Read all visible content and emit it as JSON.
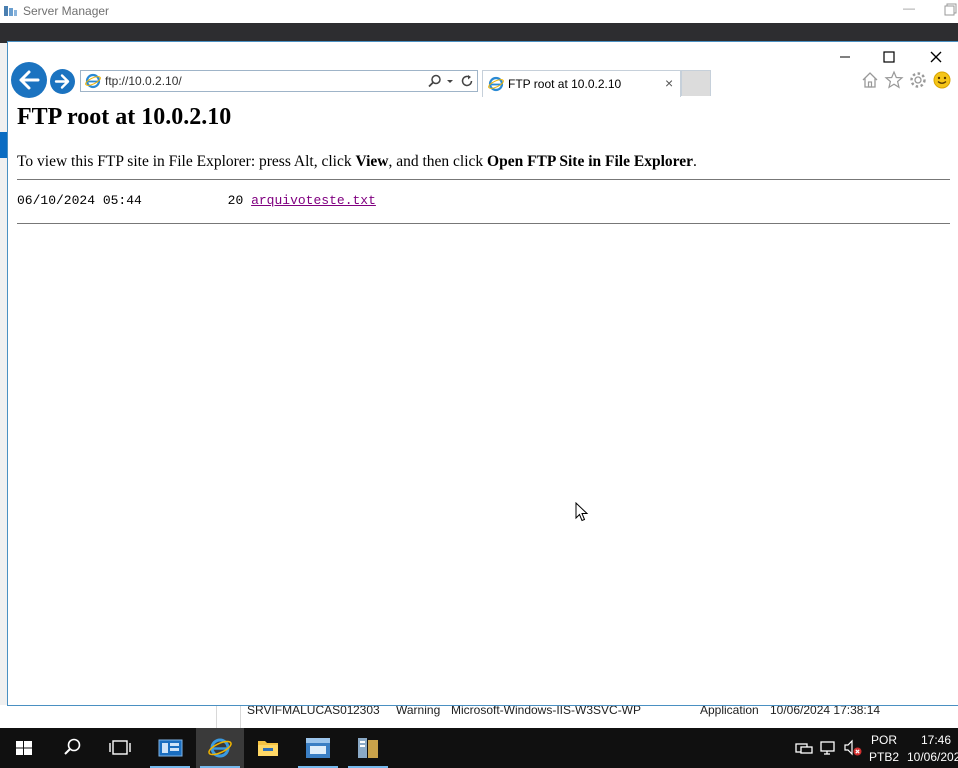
{
  "server_manager": {
    "title": "Server Manager",
    "event_row": {
      "server": "SRVIFMALUCAS01",
      "id": "2303",
      "severity": "Warning",
      "source": "Microsoft-Windows-IIS-W3SVC-WP",
      "log": "Application",
      "datetime": "10/06/2024 17:38:14"
    }
  },
  "browser": {
    "address": "ftp://10.0.2.10/",
    "tab_title": "FTP root at 10.0.2.10",
    "icons": {
      "back": "back-arrow-icon",
      "forward": "forward-arrow-icon",
      "home": "home-icon",
      "favorites": "star-icon",
      "tools": "gear-icon",
      "feedback": "smiley-icon"
    }
  },
  "page": {
    "heading": "FTP root at 10.0.2.10",
    "instr_pre": "To view this FTP site in File Explorer: press Alt, click ",
    "instr_view": "View",
    "instr_mid": ", and then click ",
    "instr_open": "Open FTP Site in File Explorer",
    "instr_end": ".",
    "files": [
      {
        "date": "06/10/2024 05:44",
        "size": "20",
        "name": "arquivoteste.txt"
      }
    ]
  },
  "taskbar": {
    "items": [
      "start-icon",
      "search-icon",
      "task-view-icon",
      "server-manager-icon",
      "internet-explorer-icon",
      "file-explorer-icon",
      "server-tools-icon",
      "event-viewer-icon"
    ],
    "tray": {
      "lang_top": "POR",
      "lang_bottom": "PTB2",
      "time": "17:46",
      "date": "10/06/202"
    }
  },
  "colors": {
    "ie_blue": "#1b73c0",
    "visited_link": "#800080",
    "taskbar": "#101010"
  }
}
